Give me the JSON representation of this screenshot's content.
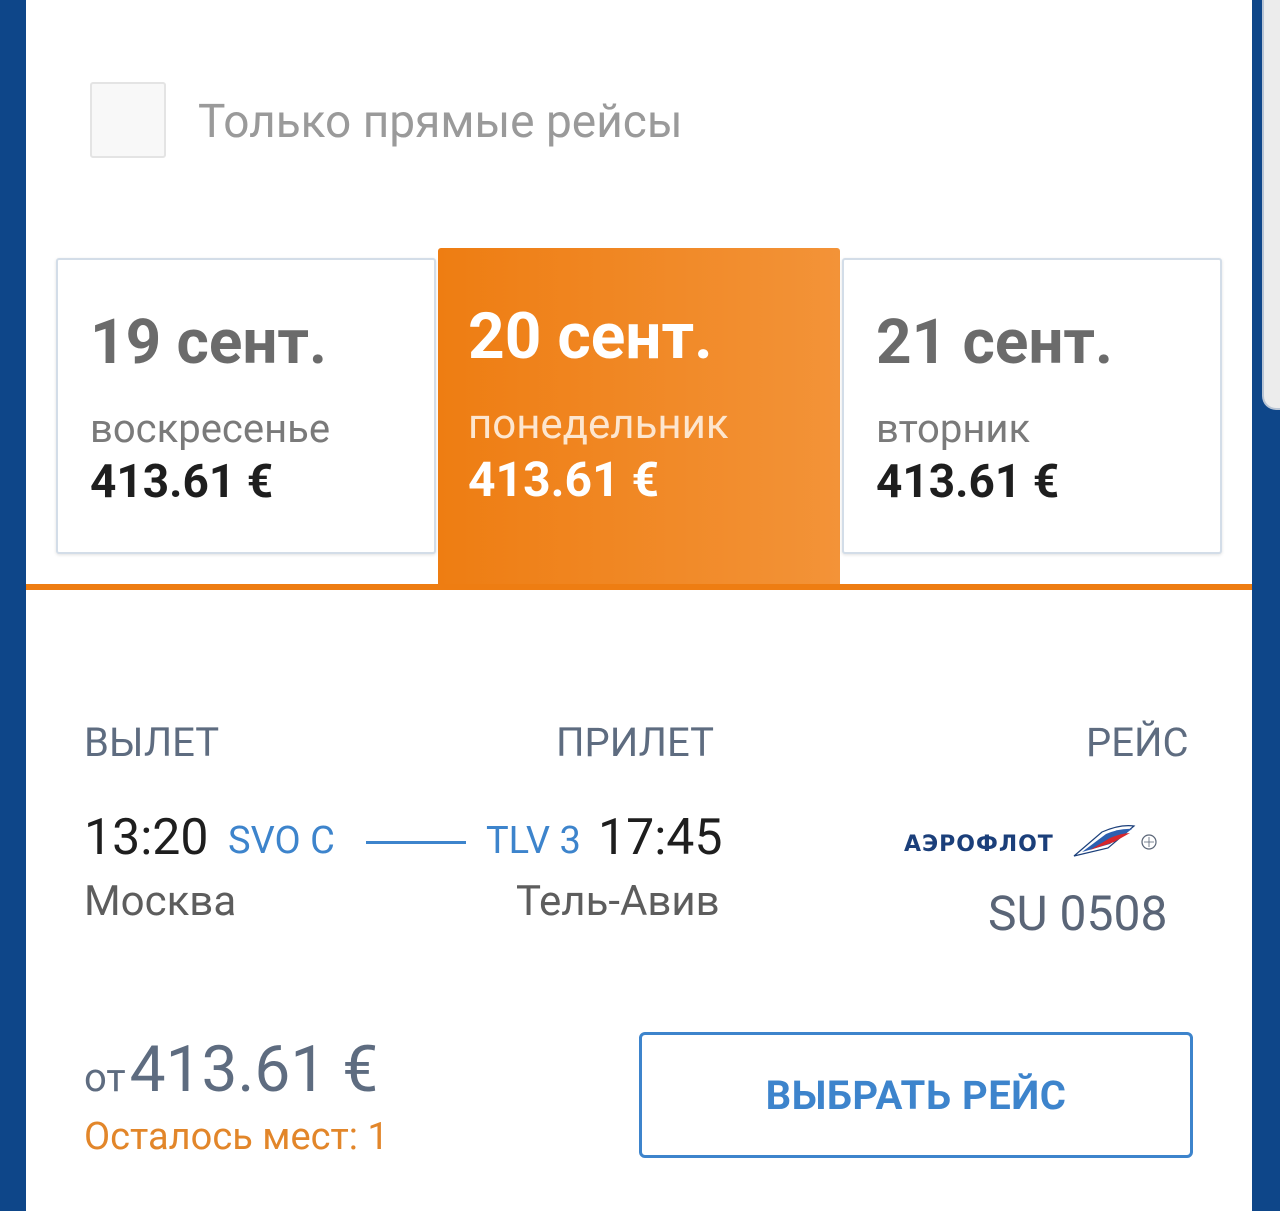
{
  "filter": {
    "direct_only_label": "Только прямые рейсы",
    "direct_only_checked": false
  },
  "dates": [
    {
      "date": "19 сент.",
      "weekday": "воскресенье",
      "price": "413.61 €"
    },
    {
      "date": "20 сент.",
      "weekday": "понедельник",
      "price": "413.61 €",
      "selected": true
    },
    {
      "date": "21 сент.",
      "weekday": "вторник",
      "price": "413.61 €"
    }
  ],
  "flight": {
    "headers": {
      "departure": "ВЫЛЕТ",
      "arrival": "ПРИЛЕТ",
      "flight": "РЕЙС"
    },
    "departure": {
      "time": "13:20",
      "code": "SVO C",
      "city": "Москва"
    },
    "arrival": {
      "time": "17:45",
      "code": "TLV 3",
      "city": "Тель-Авив"
    },
    "airline": "АЭРОФЛОТ",
    "number": "SU 0508"
  },
  "price": {
    "prefix": "от",
    "amount": "413.61 €",
    "seats_left": "Осталось мест: 1"
  },
  "actions": {
    "select_label": "ВЫБРАТЬ РЕЙС"
  },
  "colors": {
    "accent_orange": "#ee7d12",
    "accent_blue": "#3d84cc",
    "frame_blue": "#0e4689"
  }
}
